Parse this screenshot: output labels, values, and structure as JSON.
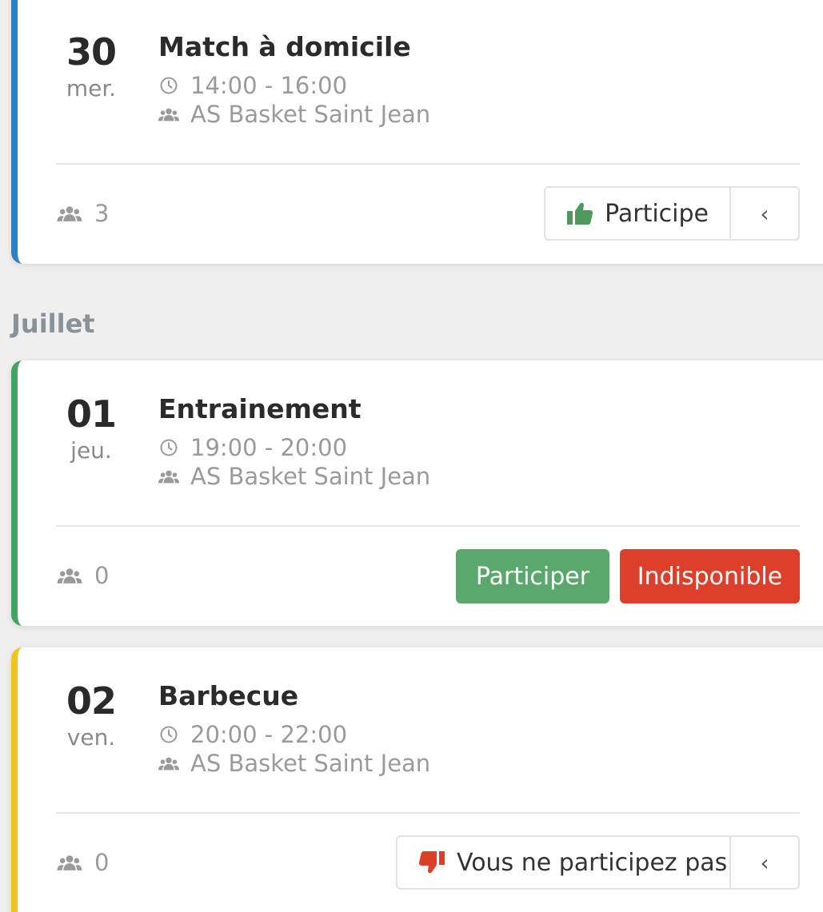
{
  "colors": {
    "blue": "#2f7fc1",
    "green": "#43a462",
    "yellow": "#f2c414",
    "accept": "#5ba86d",
    "decline": "#dd3f2a"
  },
  "months": {
    "july": "Juillet"
  },
  "events": [
    {
      "day": "30",
      "weekday": "mer.",
      "title": "Match à domicile",
      "time": "14:00 - 16:00",
      "team": "AS Basket Saint Jean",
      "participants": "3",
      "status_label": "Participe",
      "status_icon": "thumbs-up-icon"
    },
    {
      "day": "01",
      "weekday": "jeu.",
      "title": "Entrainement",
      "time": "19:00 - 20:00",
      "team": "AS Basket Saint Jean",
      "participants": "0",
      "participate_label": "Participer",
      "unavailable_label": "Indisponible"
    },
    {
      "day": "02",
      "weekday": "ven.",
      "title": "Barbecue",
      "time": "20:00 - 22:00",
      "team": "AS Basket Saint Jean",
      "participants": "0",
      "status_label": "Vous ne participez pas",
      "status_icon": "thumbs-down-icon"
    }
  ],
  "caret": "‹"
}
